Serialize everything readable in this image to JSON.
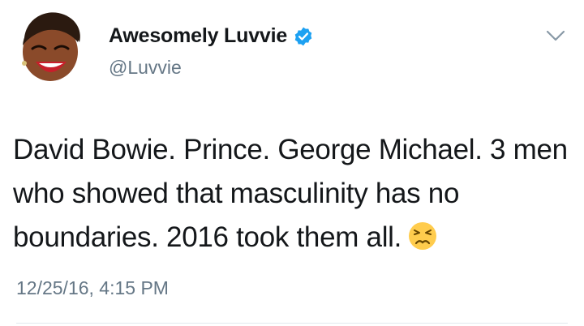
{
  "tweet": {
    "display_name": "Awesomely Luvvie",
    "handle": "@Luvvie",
    "verified": true,
    "text": "David Bowie. Prince. George Michael. 3 men who showed that masculinity has no boundaries. 2016 took them all.",
    "emoji": "persevering-face-emoji",
    "timestamp": "12/25/16, 4:15 PM"
  },
  "icons": {
    "verified": "verified-badge-icon",
    "menu": "chevron-down-icon"
  },
  "colors": {
    "text": "#14171a",
    "secondary_text": "#657786",
    "verified_blue": "#1da1f2",
    "divider": "#e1e8ed"
  }
}
